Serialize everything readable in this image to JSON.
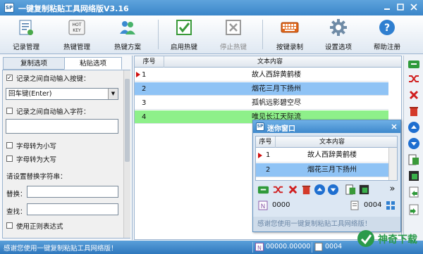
{
  "window": {
    "title": "一键复制粘贴工具网络版V3.16",
    "app_icon_text": "SP"
  },
  "toolbar": {
    "buttons": [
      {
        "label": "记录管理",
        "icon": "record-manage-icon",
        "enabled": true
      },
      {
        "label": "热键管理",
        "icon": "hotkey-icon",
        "enabled": true
      },
      {
        "label": "热键方案",
        "icon": "users-icon",
        "enabled": true
      },
      {
        "label": "启用热键",
        "icon": "checkbox-checked-icon",
        "enabled": true
      },
      {
        "label": "停止热键",
        "icon": "checkbox-cross-icon",
        "enabled": false
      },
      {
        "label": "按键录制",
        "icon": "keyboard-icon",
        "enabled": true
      },
      {
        "label": "设置选项",
        "icon": "gear-icon",
        "enabled": true
      },
      {
        "label": "帮助注册",
        "icon": "help-icon",
        "enabled": true
      }
    ],
    "hotkey_icon_text": [
      "HOT",
      "KEY"
    ]
  },
  "left_panel": {
    "tabs": [
      "复制选项",
      "粘贴选项"
    ],
    "active_tab": 1,
    "auto_key_label": "记录之间自动输入按键：",
    "auto_key_checked": true,
    "auto_key_value": "回车键(Enter)",
    "auto_char_label": "记录之间自动输入字符：",
    "auto_char_checked": false,
    "auto_char_value": "",
    "lowercase_label": "字母转为小写",
    "uppercase_label": "字母转为大写",
    "replace_title": "请设置替换字符串：",
    "replace_label": "替换：",
    "find_label": "查找：",
    "regex_label": "使用正则表达式"
  },
  "grid": {
    "headers": [
      "序号",
      "文本内容"
    ],
    "rows": [
      {
        "index": "1",
        "text": "故人西辞黄鹤楼",
        "style": "current"
      },
      {
        "index": "2",
        "text": "烟花三月下扬州",
        "style": "selected"
      },
      {
        "index": "3",
        "text": "孤帆远影碧空尽",
        "style": "normal"
      },
      {
        "index": "4",
        "text": "唯见长江天际流",
        "style": "highlight"
      }
    ]
  },
  "sidebar": {
    "icons": [
      "enter-icon",
      "shuffle-icon",
      "delete-icon",
      "trash-icon",
      "move-up-icon",
      "move-down-icon",
      "import-icon",
      "export-icon",
      "paste-icon",
      "copy-icon"
    ]
  },
  "mini_window": {
    "title": "迷你窗口",
    "headers": [
      "序号",
      "文本内容"
    ],
    "rows": [
      {
        "index": "1",
        "text": "故人西辞黄鹤楼",
        "style": "current"
      },
      {
        "index": "2",
        "text": "烟花三月下扬州",
        "style": "selected"
      }
    ],
    "more_label": "»",
    "counter_left": "0000",
    "counter_right": "0004",
    "footer": "感谢您使用一键复制粘贴工具网络版！"
  },
  "statusbar": {
    "message": "感谢您使用一键复制粘贴工具网络版！",
    "cell1": "00000.00000",
    "cell2": "0004"
  },
  "watermark": {
    "text": "神奇下载"
  },
  "colors": {
    "accent": "#3b86c9",
    "selected_row": "#8fc3f5",
    "highlight_row": "#8ef08a",
    "marker": "#d01010"
  }
}
